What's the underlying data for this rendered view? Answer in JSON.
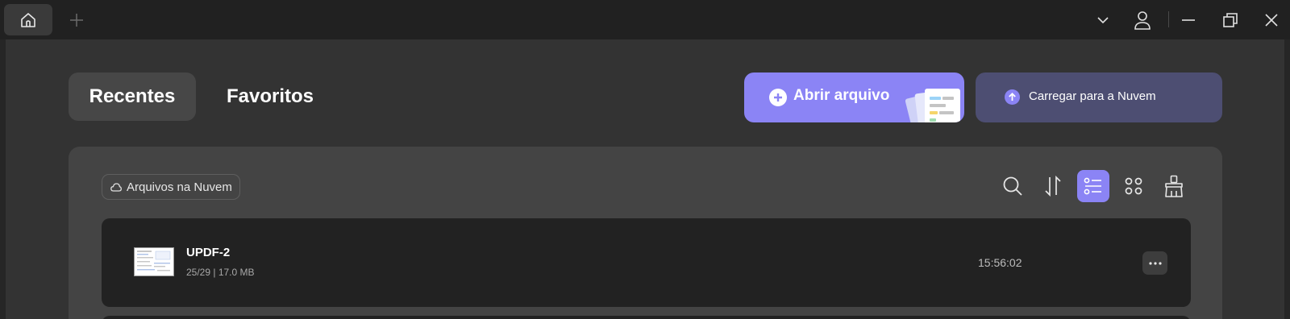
{
  "tabs": {
    "recent": "Recentes",
    "favorites": "Favoritos"
  },
  "actions": {
    "open_file": "Abrir arquivo",
    "upload_cloud": "Carregar para a Nuvem"
  },
  "filter": {
    "cloud_files": "Arquivos na Nuvem"
  },
  "toolbar_icons": [
    "search-icon",
    "sort-icon",
    "list-view-icon",
    "grid-view-icon",
    "clear-icon"
  ],
  "active_view": "list",
  "files": [
    {
      "name": "UPDF-2",
      "meta": "25/29 | 17.0 MB",
      "time": "15:56:02"
    }
  ],
  "colors": {
    "accent": "#8b84f5",
    "cloud_button": "#4d4e72",
    "titlebar": "#212121",
    "background": "#333333"
  }
}
